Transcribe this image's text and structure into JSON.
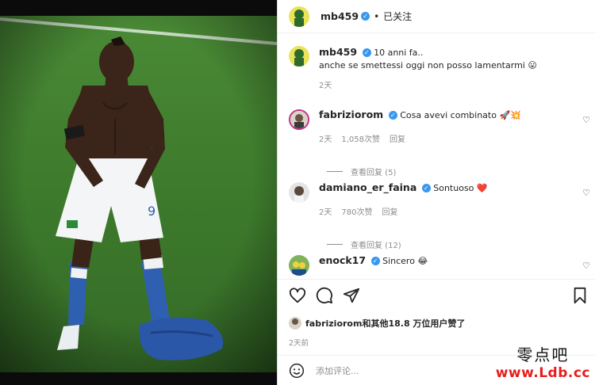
{
  "post": {
    "username": "mb459",
    "follow_status": "已关注",
    "separator": "•",
    "caption_line1": "10 anni fa..",
    "caption_line2": "anche se smettessi oggi non posso lamentarmi 😛",
    "caption_age": "2天"
  },
  "comments": [
    {
      "user": "fabriziorom",
      "text": "Cosa avevi combinato 🚀💥",
      "age": "2天",
      "likes": "1,058次赞",
      "reply": "回复",
      "view_replies": "查看回复 (5)"
    },
    {
      "user": "damiano_er_faina",
      "text": "Sontuoso ❤️",
      "age": "2天",
      "likes": "780次赞",
      "reply": "回复",
      "view_replies": "查看回复 (12)"
    },
    {
      "user": "enock17",
      "text": "Sincero 😂"
    }
  ],
  "likes_summary": {
    "user": "fabriziorom",
    "rest": "和其他18.8 万位用户赞了"
  },
  "post_age": "2天前",
  "add_comment_placeholder": "添加评论...",
  "watermark": {
    "chinese": "零点吧",
    "url": "www.Ldb.cc"
  },
  "colors": {
    "verified": "#3897f0",
    "muted": "#8e8e8e",
    "pitch": "#3f7a2e",
    "jersey_blue": "#2a57a8"
  },
  "icons": [
    "heart-icon",
    "comment-icon",
    "share-icon",
    "bookmark-icon",
    "emoji-icon",
    "verified-icon"
  ]
}
